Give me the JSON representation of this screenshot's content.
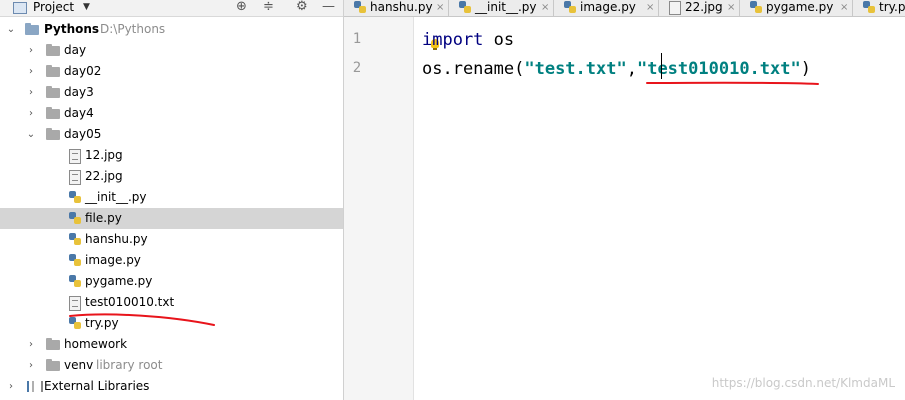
{
  "project_panel": {
    "title": "Project",
    "root": {
      "name": "Pythons",
      "path": "D:\\Pythons"
    },
    "items": [
      {
        "label": "day"
      },
      {
        "label": "day02"
      },
      {
        "label": "day3"
      },
      {
        "label": "day4"
      },
      {
        "label": "day05"
      },
      {
        "label": "12.jpg"
      },
      {
        "label": "22.jpg"
      },
      {
        "label": "__init__.py"
      },
      {
        "label": "file.py"
      },
      {
        "label": "hanshu.py"
      },
      {
        "label": "image.py"
      },
      {
        "label": "pygame.py"
      },
      {
        "label": "test010010.txt"
      },
      {
        "label": "try.py"
      },
      {
        "label": "homework"
      },
      {
        "label": "venv",
        "hint": "library root"
      },
      {
        "label": "External Libraries"
      }
    ]
  },
  "tabs": [
    {
      "label": "hanshu.py"
    },
    {
      "label": "__init__.py"
    },
    {
      "label": "image.py"
    },
    {
      "label": "22.jpg"
    },
    {
      "label": "pygame.py"
    },
    {
      "label": "try.py"
    }
  ],
  "editor": {
    "line_numbers": [
      "1",
      "2"
    ],
    "line1": {
      "kw": "import",
      "rest": " os"
    },
    "line2": {
      "prefix": "os.rename(",
      "arg1": "\"test.txt\"",
      "comma": ",",
      "arg2": "\"test010010.txt\"",
      "suffix": ")"
    }
  },
  "watermark": "https://blog.csdn.net/KlmdaML",
  "colors": {
    "selection": "#d5d5d5",
    "annotation": "#e8141b",
    "string": "#008080",
    "keyword": "#000080"
  },
  "icons": {
    "header": [
      "project-icon",
      "crosshair-icon",
      "collapse-icon",
      "gear-icon",
      "minimize-icon"
    ],
    "tree": [
      "chevron-icon",
      "folder-icon",
      "image-file-icon",
      "python-file-icon",
      "text-file-icon",
      "library-icon"
    ]
  }
}
